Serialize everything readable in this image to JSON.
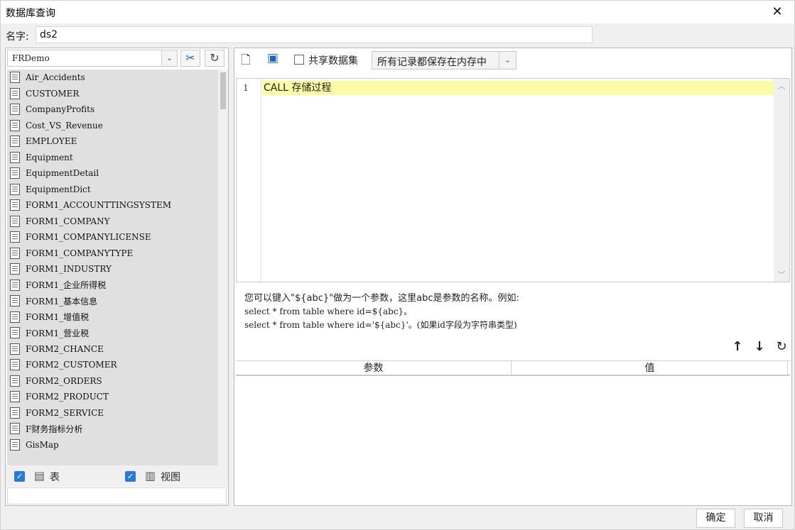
{
  "window": {
    "title": "数据库查询",
    "close_glyph": "✕"
  },
  "name_field": {
    "label": "名字:",
    "value": "ds2"
  },
  "left": {
    "database": "FRDemo",
    "tables": [
      "Air_Accidents",
      "CUSTOMER",
      "CompanyProfits",
      "Cost_VS_Revenue",
      "EMPLOYEE",
      "Equipment",
      "EquipmentDetail",
      "EquipmentDict",
      "FORM1_ACCOUNTTINGSYSTEM",
      "FORM1_COMPANY",
      "FORM1_COMPANYLICENSE",
      "FORM1_COMPANYTYPE",
      "FORM1_INDUSTRY",
      "FORM1_企业所得税",
      "FORM1_基本信息",
      "FORM1_增值税",
      "FORM1_营业税",
      "FORM2_CHANCE",
      "FORM2_CUSTOMER",
      "FORM2_ORDERS",
      "FORM2_PRODUCT",
      "FORM2_SERVICE",
      "F财务指标分析",
      "GisMap"
    ],
    "filters": {
      "table_label": "表",
      "view_label": "视图",
      "table_checked": true,
      "view_checked": true
    }
  },
  "toolbar": {
    "share_label": "共享数据集",
    "cache_mode": "所有记录都保存在内存中"
  },
  "editor": {
    "line_numbers": [
      "1"
    ],
    "code": "CALL 存储过程"
  },
  "hint": {
    "line1": "您可以键入\"${abc}\"做为一个参数，这里abc是参数的名称。例如:",
    "line2": "select * from table where id=${abc}。",
    "line3": "select * from table where id='${abc}'。(如果id字段为字符串类型)"
  },
  "params": {
    "col_param": "参数",
    "col_value": "值"
  },
  "footer": {
    "ok": "确定",
    "cancel": "取消"
  }
}
